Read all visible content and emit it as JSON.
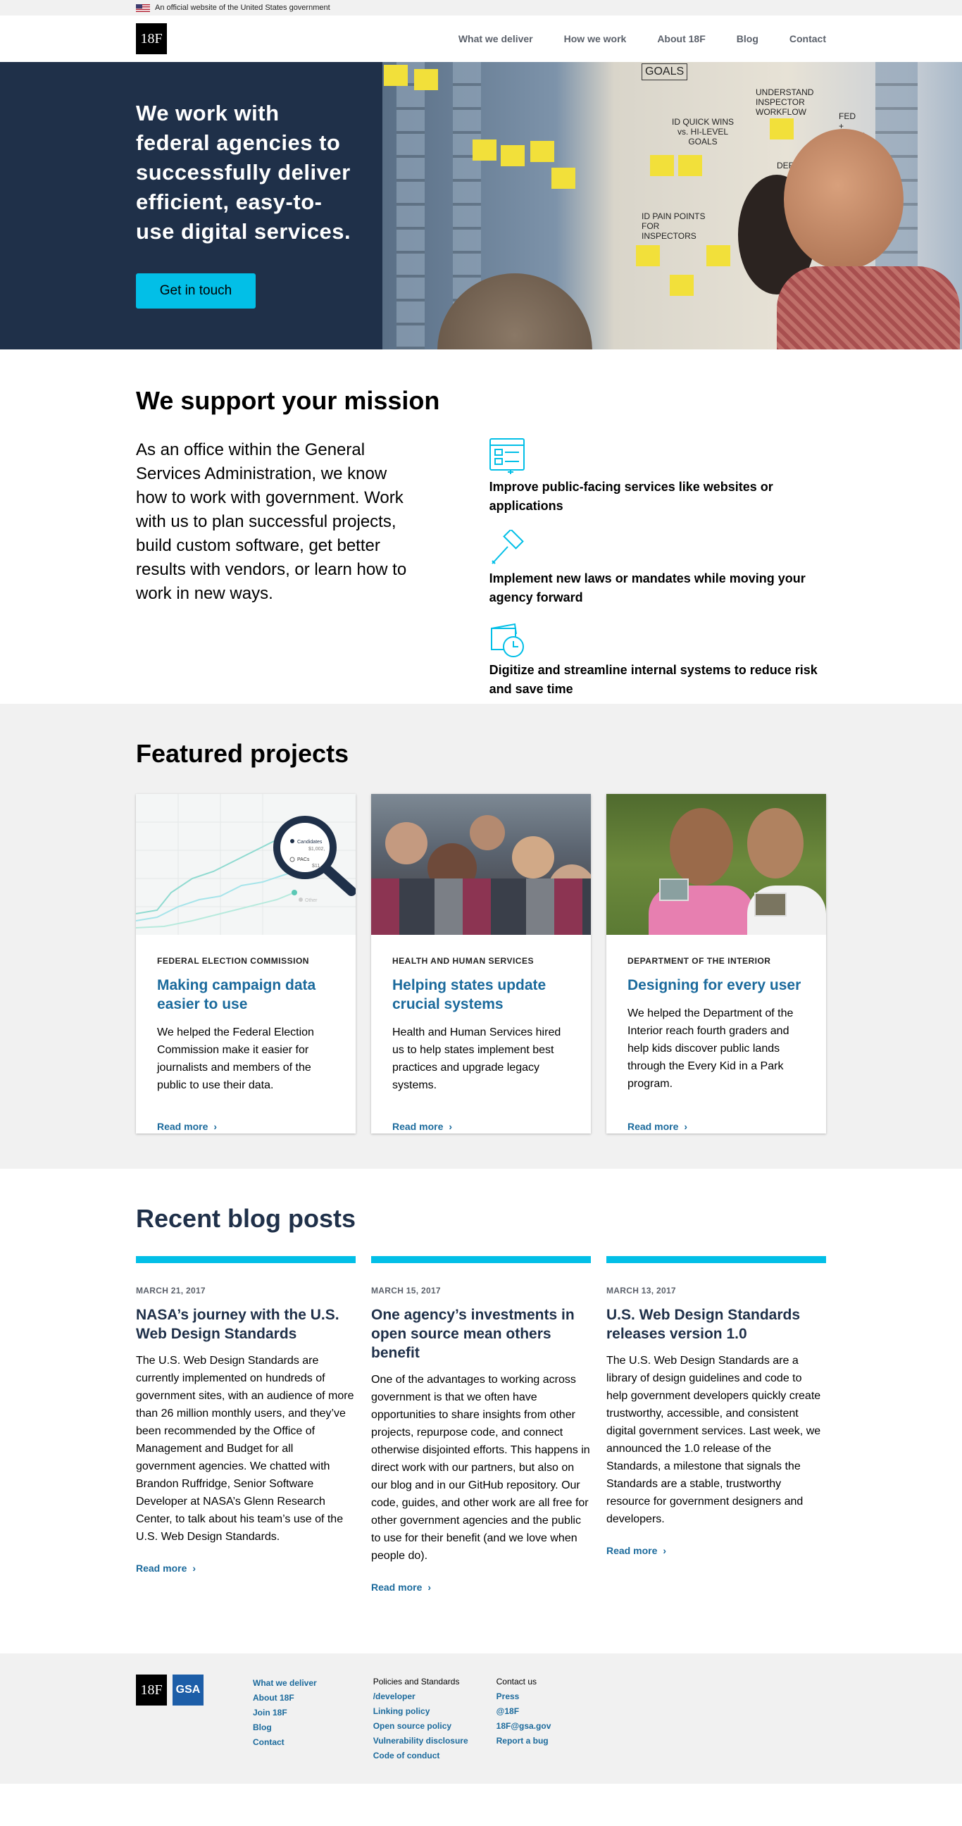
{
  "gov_banner": {
    "text": "An official website of the United States government"
  },
  "header": {
    "logo": "18F",
    "nav": [
      "What we deliver",
      "How we work",
      "About 18F",
      "Blog",
      "Contact"
    ]
  },
  "hero": {
    "headline": "We work with federal agencies to successfully deliver efficient, easy-to-use digital services.",
    "cta": "Get in touch",
    "photo_text": [
      "GOALS",
      "UNDERSTAND INSPECTOR WORKFLOW",
      "FED + STATE",
      "ID QUICK WINS vs. HI-LEVEL GOALS",
      "DEFINE",
      "ID PAIN POINTS FOR INSPECTORS"
    ]
  },
  "mission": {
    "heading": "We support your mission",
    "lead": "As an office within the General Services Administration, we know how to work with government. Work with us to plan successful projects, build custom software, get better results with vendors, or learn how to work in new ways.",
    "points": [
      {
        "icon": "website-icon",
        "text": "Improve public-facing services like websites or applications"
      },
      {
        "icon": "gavel-icon",
        "text": "Implement new laws or mandates while moving your agency forward"
      },
      {
        "icon": "clock-document-icon",
        "text": "Digitize and streamline internal systems to reduce risk and save time"
      }
    ]
  },
  "featured": {
    "heading": "Featured projects",
    "card1_labels": [
      "Candidates",
      "$1,002,",
      "PACs",
      "$11,",
      "Other"
    ],
    "cards": [
      {
        "agency": "FEDERAL ELECTION COMMISSION",
        "title": "Making campaign data easier to use",
        "desc": "We helped the Federal Election Commission make it easier for journalists and members of the public to use their data.",
        "more": "Read more"
      },
      {
        "agency": "HEALTH AND HUMAN SERVICES",
        "title": "Helping states update crucial systems",
        "desc": "Health and Human Services hired us to help states implement best practices and upgrade legacy systems.",
        "more": "Read more"
      },
      {
        "agency": "DEPARTMENT OF THE INTERIOR",
        "title": "Designing for every user",
        "desc": "We helped the Department of the Interior reach fourth graders and help kids discover public lands through the Every Kid in a Park program.",
        "more": "Read more"
      }
    ]
  },
  "blog": {
    "heading": "Recent blog posts",
    "posts": [
      {
        "date": "MARCH 21, 2017",
        "title": "NASA’s journey with the U.S. Web Design Standards",
        "body": "The U.S. Web Design Standards are currently implemented on hundreds of government sites, with an audience of more than 26 million monthly users, and they’ve been recommended by the Office of Management and Budget for all government agencies. We chatted with Brandon Ruffridge, Senior Software Developer at NASA’s Glenn Research Center, to talk about his team’s use of the U.S. Web Design Standards.",
        "more": "Read more"
      },
      {
        "date": "MARCH 15, 2017",
        "title": "One agency’s investments in open source mean others benefit",
        "body": "One of the advantages to working across government is that we often have opportunities to share insights from other projects, repurpose code, and connect otherwise disjointed efforts. This happens in direct work with our partners, but also on our blog and in our GitHub repository. Our code, guides, and other work are all free for other government agencies and the public to use for their benefit (and we love when people do).",
        "more": "Read more"
      },
      {
        "date": "MARCH 13, 2017",
        "title": "U.S. Web Design Standards releases version 1.0",
        "body": "The U.S. Web Design Standards are a library of design guidelines and code to help government developers quickly create trustworthy, accessible, and consistent digital government services. Last week, we announced the 1.0 release of the Standards, a milestone that signals the Standards are a stable, trustworthy resource for government designers and developers.",
        "more": "Read more"
      }
    ]
  },
  "footer": {
    "logo_18f": "18F",
    "logo_gsa": "GSA",
    "col1": [
      "What we deliver",
      "About 18F",
      "Join 18F",
      "Blog",
      "Contact"
    ],
    "col2_heading": "Policies and Standards",
    "col2": [
      "/developer",
      "Linking policy",
      "Open source policy",
      "Vulnerability disclosure",
      "Code of conduct"
    ],
    "col3_heading": "Contact us",
    "col3": [
      "Press",
      "@18F",
      "18F@gsa.gov",
      "Report a bug"
    ]
  }
}
